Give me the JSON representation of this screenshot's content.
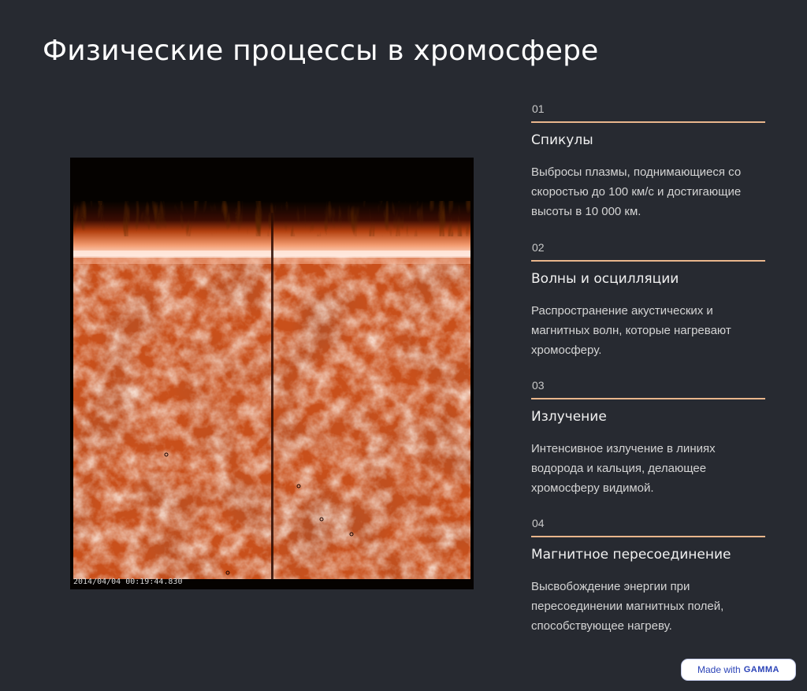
{
  "page": {
    "title": "Физические процессы в хромосфере"
  },
  "image": {
    "timestamp": "2014/04/04 00:19:44.830",
    "colors": {
      "limb": "#ffe9dd",
      "disk": "#c54a16",
      "space": "#050200"
    }
  },
  "items": [
    {
      "number": "01",
      "title": "Спикулы",
      "description": "Выбросы плазмы, поднимающиеся со скоростью до 100 км/с и достигающие высоты в 10 000 км."
    },
    {
      "number": "02",
      "title": "Волны и осцилляции",
      "description": "Распространение акустических и магнитных волн, которые нагревают хромосферу."
    },
    {
      "number": "03",
      "title": "Излучение",
      "description": "Интенсивное излучение в линиях водорода и кальция, делающее хромосферу видимой."
    },
    {
      "number": "04",
      "title": "Магнитное пересоединение",
      "description": "Высвобождение энергии при пересоединении магнитных полей, способствующее нагреву."
    }
  ],
  "accent_color": "#e9b68c",
  "badge": {
    "prefix": "Made with",
    "brand": "GAMMA"
  }
}
